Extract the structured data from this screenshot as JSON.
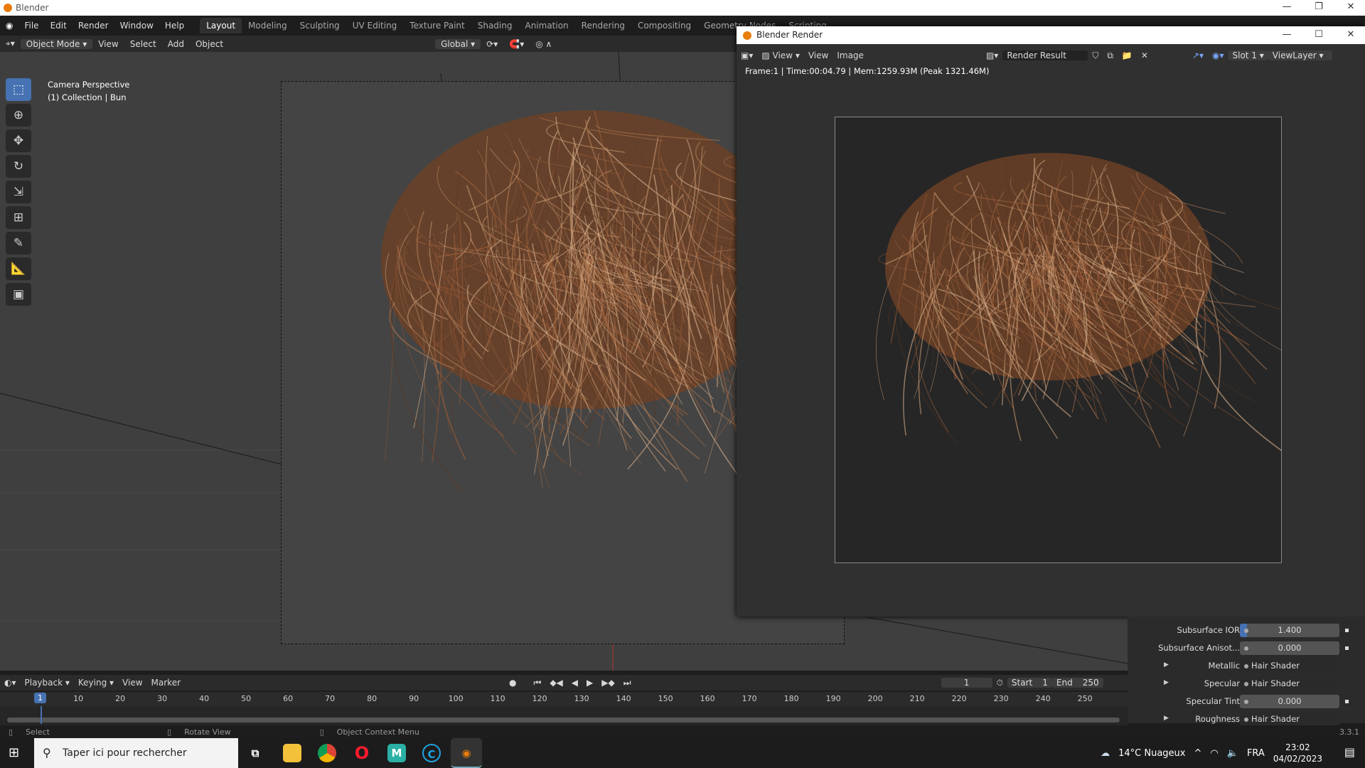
{
  "window": {
    "title": "Blender",
    "min": "—",
    "max": "❐",
    "close": "✕"
  },
  "menu": [
    "File",
    "Edit",
    "Render",
    "Window",
    "Help"
  ],
  "workspaces": [
    "Layout",
    "Modeling",
    "Sculpting",
    "UV Editing",
    "Texture Paint",
    "Shading",
    "Animation",
    "Rendering",
    "Compositing",
    "Geometry Nodes",
    "Scripting"
  ],
  "header": {
    "mode": "Object Mode",
    "items": [
      "View",
      "Select",
      "Add",
      "Object"
    ],
    "orientation": "Global"
  },
  "overlay": {
    "line1": "Camera Perspective",
    "line2": "(1) Collection | Bun"
  },
  "render_window": {
    "title": "Blender Render",
    "view_dd": "View",
    "menus": [
      "View",
      "Image"
    ],
    "image_name": "Render Result",
    "slot": "Slot 1",
    "layer": "ViewLayer",
    "info": "Frame:1 | Time:00:04.79 | Mem:1259.93M (Peak 1321.46M)"
  },
  "properties": [
    {
      "label": "Subsurface IOR",
      "value": "1.400",
      "type": "num",
      "fill": 0.07
    },
    {
      "label": "Subsurface Anisot...",
      "value": "0.000",
      "type": "num"
    },
    {
      "label": "Metallic",
      "value": "Hair Shader",
      "type": "link"
    },
    {
      "label": "Specular",
      "value": "Hair Shader",
      "type": "link"
    },
    {
      "label": "Specular Tint",
      "value": "0.000",
      "type": "num"
    },
    {
      "label": "Roughness",
      "value": "Hair Shader",
      "type": "link"
    }
  ],
  "timeline": {
    "menus": [
      "Playback",
      "Keying",
      "View",
      "Marker"
    ],
    "current": "1",
    "start_label": "Start",
    "start": "1",
    "end_label": "End",
    "end": "250",
    "ticks": [
      "10",
      "20",
      "30",
      "40",
      "50",
      "60",
      "70",
      "80",
      "90",
      "100",
      "110",
      "120",
      "130",
      "140",
      "150",
      "160",
      "170",
      "180",
      "190",
      "200",
      "210",
      "220",
      "230",
      "240",
      "250"
    ]
  },
  "status": {
    "select": "Select",
    "rotate": "Rotate View",
    "context": "Object Context Menu",
    "version": "3.3.1"
  },
  "taskbar": {
    "search": "Taper ici pour rechercher",
    "weather": "14°C  Nuageux",
    "lang": "FRA",
    "time": "23:02",
    "date": "04/02/2023"
  }
}
